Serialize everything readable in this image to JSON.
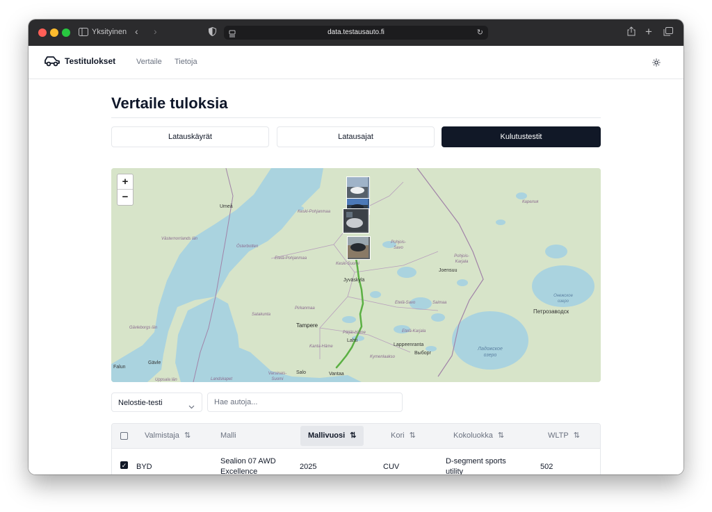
{
  "browser": {
    "profile_label": "Yksityinen",
    "url": "data.testausauto.fi"
  },
  "nav": {
    "brand": "Testitulokset",
    "links": [
      "Vertaile",
      "Tietoja"
    ]
  },
  "page": {
    "title": "Vertaile tuloksia",
    "tabs": [
      {
        "label": "Latauskäyrät",
        "active": false
      },
      {
        "label": "Latausajat",
        "active": false
      },
      {
        "label": "Kulutustestit",
        "active": true
      }
    ]
  },
  "map": {
    "zoom_in": "+",
    "zoom_out": "−",
    "route_color": "#5bb043",
    "labels": {
      "umea": "Umeå",
      "vasternorrland": "Västernorrlands län",
      "osterbotten": "Österbotten",
      "keski_pohjanmaa": "Keski-Pohjanmaa",
      "etela_pohjanmaa": "Etelä-Pohjanmaa",
      "keski_suomi": "Keski-Suomi",
      "jyvaskyla": "Jyväskylä",
      "pohjois_savo": "Pohjois-Savo",
      "pohjois_karjala": "Pohjois-Karjala",
      "joensuu": "Joensuu",
      "karelia": "Карелия",
      "etela_savo": "Etelä-Savo",
      "saimaa": "Saimaa",
      "pirkanmaa": "Pirkanmaa",
      "satakunta": "Satakunta",
      "tampere": "Tampere",
      "paijat_hame": "Päijät-Häme",
      "etela_karjala": "Etelä-Karjala",
      "lahti": "Lahti",
      "kanta_hame": "Kanta-Häme",
      "lappeenranta": "Lappeenranta",
      "vyborg": "Выборг",
      "kymenlaakso": "Kymenlaakso",
      "gavleborg": "Gävleborgs län",
      "falun": "Falun",
      "gavle": "Gävle",
      "varsinais": "Varsinais-Suomi",
      "salo": "Salo",
      "vantaa": "Vantaa",
      "uppsala": "Uppsala län",
      "landskapet": "Landskapet",
      "petrozavodsk": "Петрозаводск",
      "onega": "Онежское озеро",
      "ladoga": "Ладожское озеро"
    }
  },
  "filters": {
    "test_select": "Nelostie-testi",
    "search_placeholder": "Hae autoja..."
  },
  "table": {
    "columns": [
      "Valmistaja",
      "Malli",
      "Mallivuosi",
      "Kori",
      "Kokoluokka",
      "WLTP"
    ],
    "sorted_column": "Mallivuosi",
    "rows": [
      {
        "selected": true,
        "valmistaja": "BYD",
        "malli": "Sealion 07 AWD Excellence",
        "mallivuosi": "2025",
        "kori": "CUV",
        "kokoluokka": "D-segment sports utility",
        "wltp": "502"
      }
    ]
  }
}
